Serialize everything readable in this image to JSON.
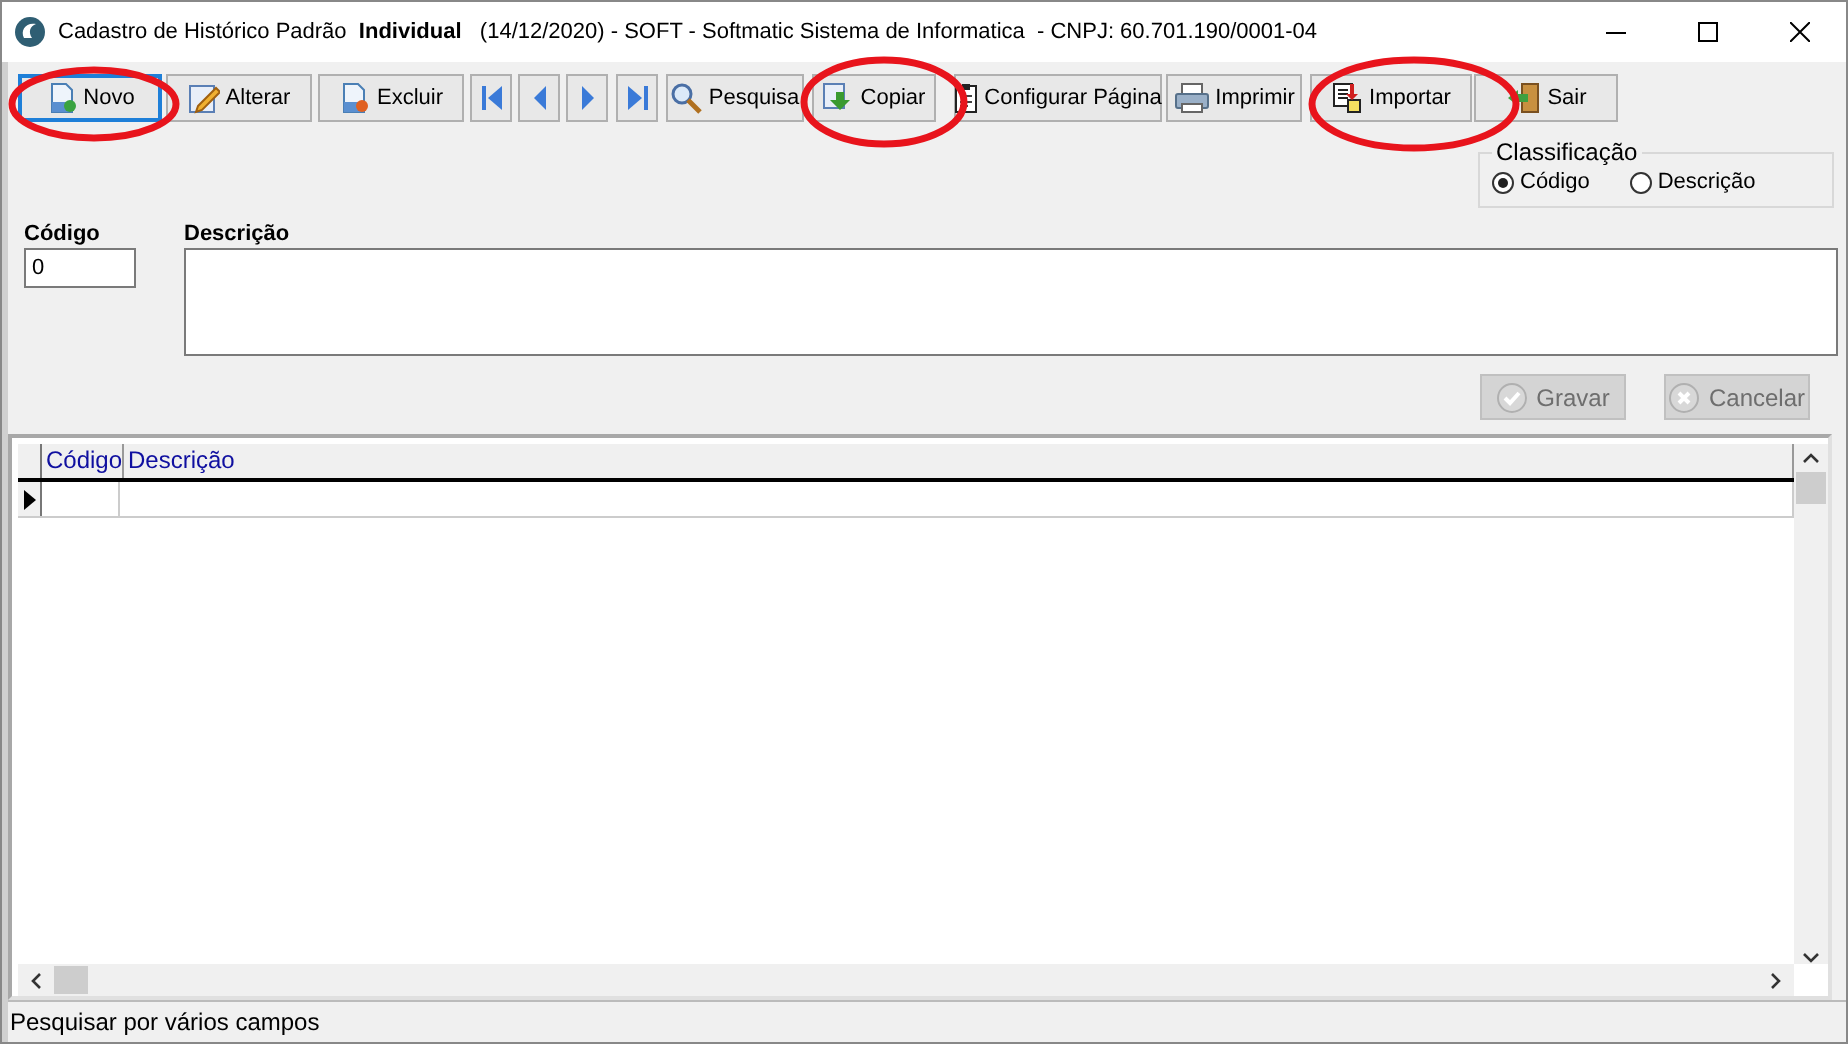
{
  "window": {
    "title": "Cadastro de Histórico Padrão  **Individual**   (14/12/2020) - SOFT - Softmatic Sistema de Informatica  - CNPJ: 60.701.190/0001-04"
  },
  "toolbar": [
    {
      "label": "Novo",
      "focused": true
    },
    {
      "label": "Alterar",
      "focused": false
    },
    {
      "label": "Excluir",
      "focused": false
    },
    {
      "focused": false
    },
    {
      "focused": false
    },
    {
      "focused": false
    },
    {
      "focused": false
    },
    {
      "label": "Pesquisa",
      "focused": false
    },
    {
      "label": "Copiar",
      "focused": false
    },
    {
      "label": "Configurar Página",
      "focused": false
    },
    {
      "label": "Imprimir",
      "focused": false
    },
    {
      "label": "Importar",
      "focused": false
    },
    {
      "label": "Sair",
      "focused": false
    }
  ],
  "classificacao": {
    "title": "Classificação",
    "options": [
      {
        "label": "Código",
        "selected": true
      },
      {
        "label": "Descrição",
        "selected": false
      }
    ]
  },
  "form": {
    "codigo": {
      "label": "Código",
      "value": "0"
    },
    "descricao": {
      "label": "Descrição"
    }
  },
  "actions": [
    {
      "label": "Gravar",
      "disabled": true
    },
    {
      "label": "Cancelar",
      "disabled": true
    }
  ],
  "grid": {
    "columns": [
      "Código",
      "Descrição"
    ],
    "rows": [
      {
        "cells": [
          "",
          ""
        ],
        "current": true
      }
    ]
  },
  "status_bar": "Pesquisar por vários campos"
}
